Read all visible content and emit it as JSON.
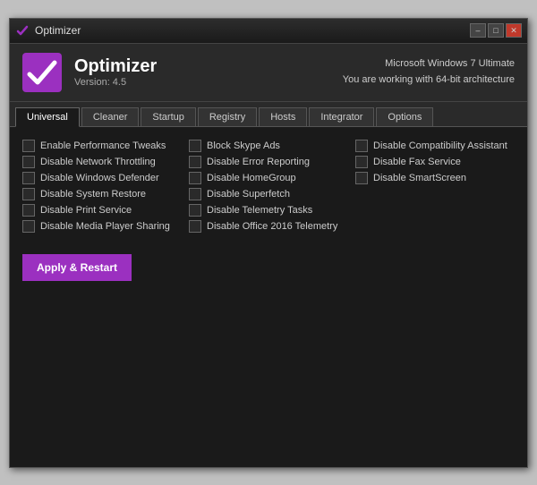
{
  "titlebar": {
    "title": "Optimizer",
    "min_label": "–",
    "max_label": "□",
    "close_label": "✕"
  },
  "header": {
    "app_name": "Optimizer",
    "version": "Version: 4.5",
    "os_info": "Microsoft Windows 7 Ultimate",
    "arch_info": "You are working with 64-bit architecture"
  },
  "tabs": [
    {
      "id": "universal",
      "label": "Universal",
      "active": true
    },
    {
      "id": "cleaner",
      "label": "Cleaner",
      "active": false
    },
    {
      "id": "startup",
      "label": "Startup",
      "active": false
    },
    {
      "id": "registry",
      "label": "Registry",
      "active": false
    },
    {
      "id": "hosts",
      "label": "Hosts",
      "active": false
    },
    {
      "id": "integrator",
      "label": "Integrator",
      "active": false
    },
    {
      "id": "options",
      "label": "Options",
      "active": false
    }
  ],
  "options": {
    "col1": [
      "Enable Performance Tweaks",
      "Disable Network Throttling",
      "Disable Windows Defender",
      "Disable System Restore",
      "Disable Print Service",
      "Disable Media Player Sharing"
    ],
    "col2": [
      "Block Skype Ads",
      "Disable Error Reporting",
      "Disable HomeGroup",
      "Disable Superfetch",
      "Disable Telemetry Tasks",
      "Disable Office 2016 Telemetry"
    ],
    "col3": [
      "Disable Compatibility Assistant",
      "Disable Fax Service",
      "Disable SmartScreen"
    ]
  },
  "apply_button": "Apply & Restart"
}
